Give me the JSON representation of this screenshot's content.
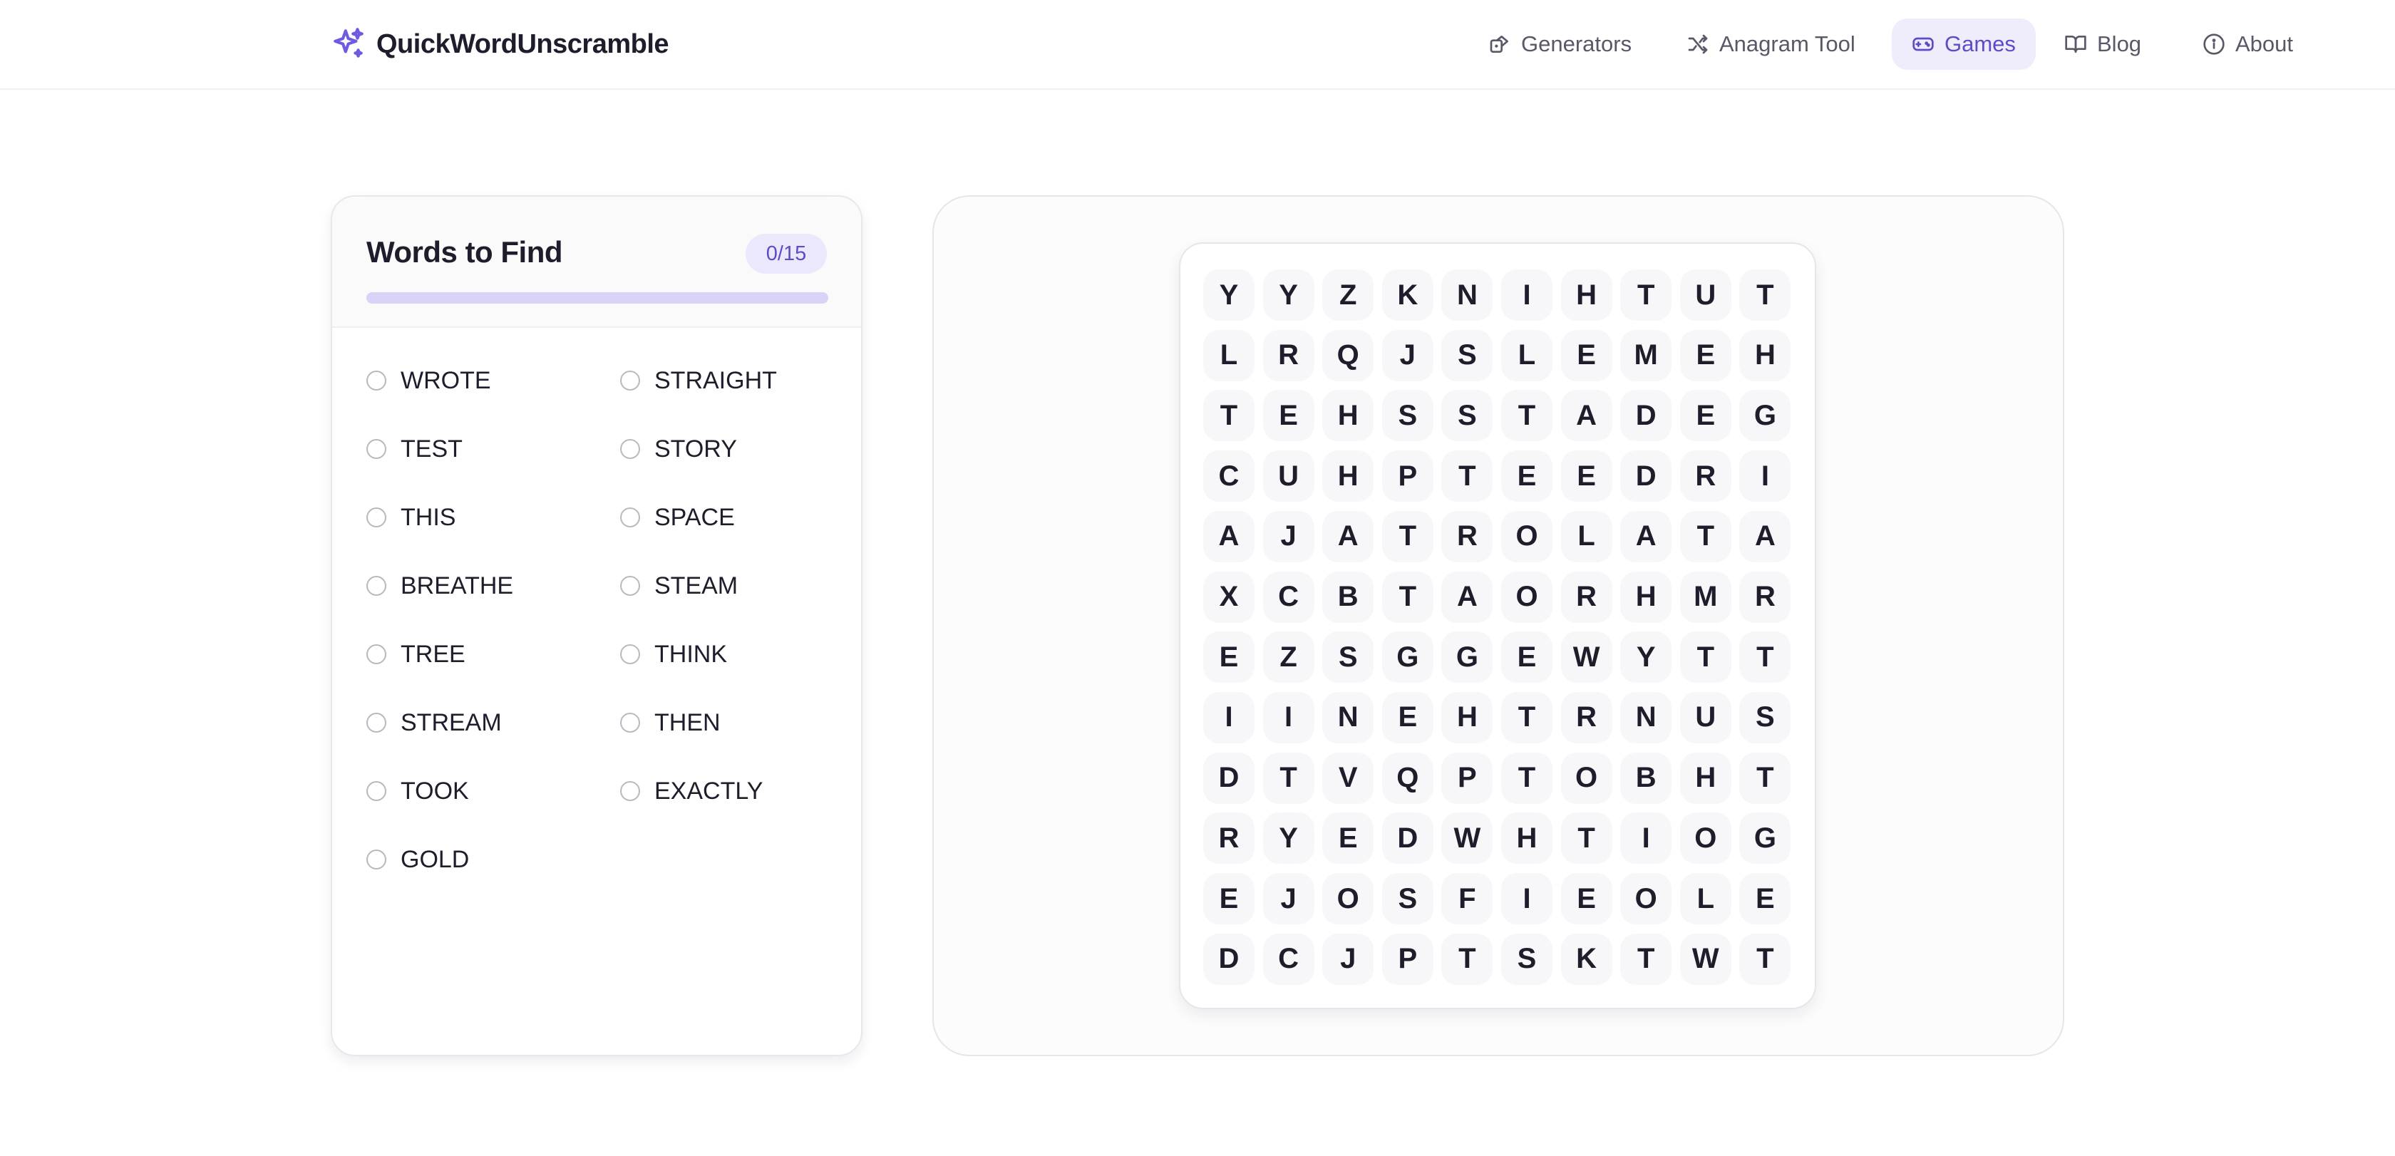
{
  "brand": {
    "name": "QuickWordUnscramble",
    "color": "#6d5ce0"
  },
  "nav": [
    {
      "label": "Generators",
      "icon": "dice-icon",
      "active": false
    },
    {
      "label": "Anagram Tool",
      "icon": "shuffle-icon",
      "active": false
    },
    {
      "label": "Games",
      "icon": "gamepad-icon",
      "active": true
    },
    {
      "label": "Blog",
      "icon": "book-icon",
      "active": false
    },
    {
      "label": "About",
      "icon": "info-icon",
      "active": false
    }
  ],
  "words_panel": {
    "title": "Words to Find",
    "count": "0/15",
    "progress": 0,
    "words": [
      "WROTE",
      "STRAIGHT",
      "TEST",
      "STORY",
      "THIS",
      "SPACE",
      "BREATHE",
      "STEAM",
      "TREE",
      "THINK",
      "STREAM",
      "THEN",
      "TOOK",
      "EXACTLY",
      "GOLD"
    ]
  },
  "grid": [
    [
      "Y",
      "Y",
      "Z",
      "K",
      "N",
      "I",
      "H",
      "T",
      "U",
      "T"
    ],
    [
      "L",
      "R",
      "Q",
      "J",
      "S",
      "L",
      "E",
      "M",
      "E",
      "H"
    ],
    [
      "T",
      "E",
      "H",
      "S",
      "S",
      "T",
      "A",
      "D",
      "E",
      "G"
    ],
    [
      "C",
      "U",
      "H",
      "P",
      "T",
      "E",
      "E",
      "D",
      "R",
      "I"
    ],
    [
      "A",
      "J",
      "A",
      "T",
      "R",
      "O",
      "L",
      "A",
      "T",
      "A"
    ],
    [
      "X",
      "C",
      "B",
      "T",
      "A",
      "O",
      "R",
      "H",
      "M",
      "R"
    ],
    [
      "E",
      "Z",
      "S",
      "G",
      "G",
      "E",
      "W",
      "Y",
      "T",
      "T"
    ],
    [
      "I",
      "I",
      "N",
      "E",
      "H",
      "T",
      "R",
      "N",
      "U",
      "S"
    ],
    [
      "D",
      "T",
      "V",
      "Q",
      "P",
      "T",
      "O",
      "B",
      "H",
      "T"
    ],
    [
      "R",
      "Y",
      "E",
      "D",
      "W",
      "H",
      "T",
      "I",
      "O",
      "G"
    ],
    [
      "E",
      "J",
      "O",
      "S",
      "F",
      "I",
      "E",
      "O",
      "L",
      "E"
    ],
    [
      "D",
      "C",
      "J",
      "P",
      "T",
      "S",
      "K",
      "T",
      "W",
      "T"
    ]
  ]
}
